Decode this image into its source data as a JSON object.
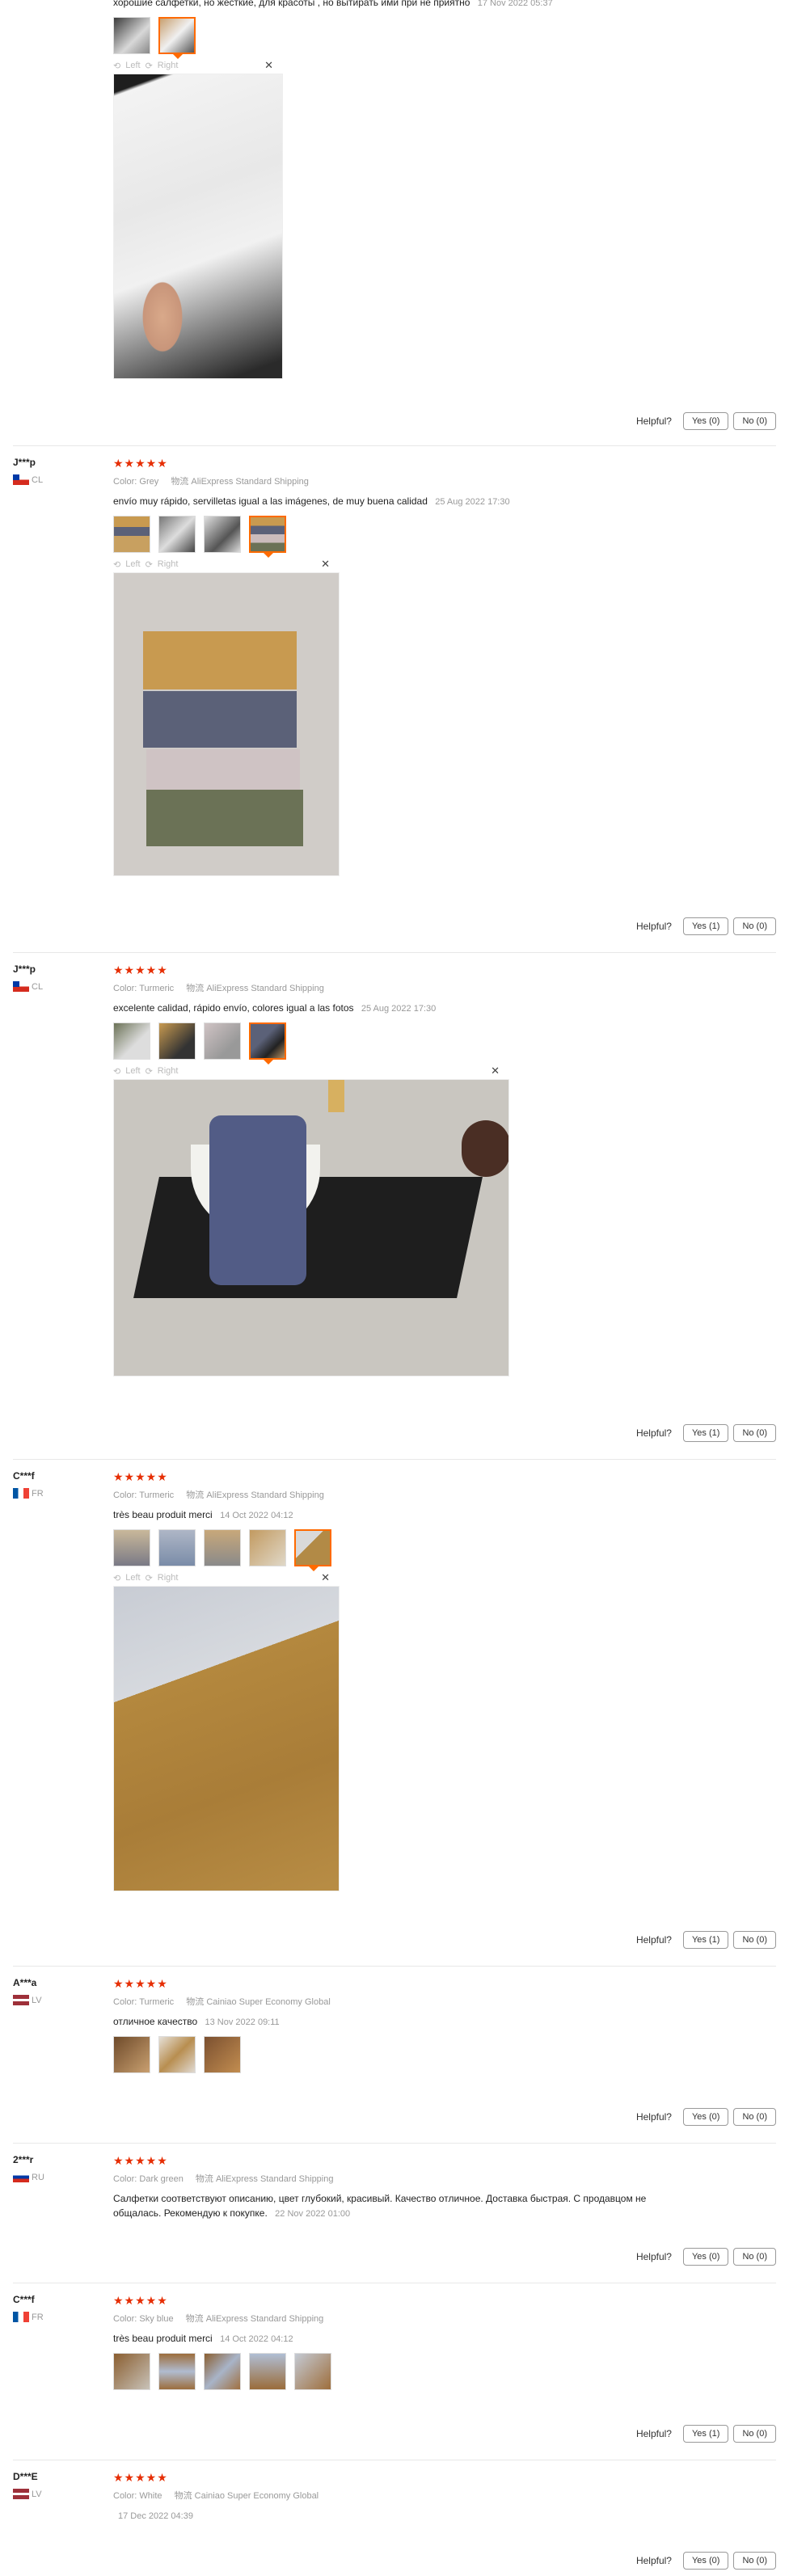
{
  "helpful_label": "Helpful?",
  "rating_stars": "★★★★★",
  "color_prefix": "Color:",
  "ship_prefix": "物流",
  "viewer": {
    "left": "Left",
    "right": "Right",
    "close": "✕"
  },
  "colors": {
    "accent": "#ff6a00",
    "star": "#e62e04"
  },
  "reviews": [
    {
      "text": "хорошие салфетки, но жёсткие, для красоты , но вытирать ими при не приятно",
      "date": "17 Nov 2022 05:37",
      "yes": "Yes (0)",
      "no": "No (0)"
    },
    {
      "user": "J***p",
      "country": "CL",
      "color": "Grey",
      "shipping": "AliExpress Standard Shipping",
      "text": "envío muy rápido, servilletas igual a las imágenes, de muy buena calidad",
      "date": "25 Aug 2022 17:30",
      "yes": "Yes (1)",
      "no": "No (0)"
    },
    {
      "user": "J***p",
      "country": "CL",
      "color": "Turmeric",
      "shipping": "AliExpress Standard Shipping",
      "text": "excelente calidad, rápido envío, colores igual a las fotos",
      "date": "25 Aug 2022 17:30",
      "yes": "Yes (1)",
      "no": "No (0)"
    },
    {
      "user": "C***f",
      "country": "FR",
      "color": "Turmeric",
      "shipping": "AliExpress Standard Shipping",
      "text": "très beau produit merci",
      "date": "14 Oct 2022 04:12",
      "yes": "Yes (1)",
      "no": "No (0)"
    },
    {
      "user": "A***a",
      "country": "LV",
      "color": "Turmeric",
      "shipping": "Cainiao Super Economy Global",
      "text": "отличное качество",
      "date": "13 Nov 2022 09:11",
      "yes": "Yes (0)",
      "no": "No (0)"
    },
    {
      "user": "2***r",
      "country": "RU",
      "color": "Dark green",
      "shipping": "AliExpress Standard Shipping",
      "text": "Салфетки соответствуют описанию, цвет глубокий, красивый. Качество отличное. Доставка быстрая. С продавцом не общалась. Рекомендую к покупке.",
      "date": "22 Nov 2022 01:00",
      "yes": "Yes (0)",
      "no": "No (0)"
    },
    {
      "user": "C***f",
      "country": "FR",
      "color": "Sky blue",
      "shipping": "AliExpress Standard Shipping",
      "text": "très beau produit merci",
      "date": "14 Oct 2022 04:12",
      "yes": "Yes (1)",
      "no": "No (0)"
    },
    {
      "user": "D***E",
      "country": "LV",
      "color": "White",
      "shipping": "Cainiao Super Economy Global",
      "text": "",
      "date": "17 Dec 2022 04:39",
      "yes": "Yes (0)",
      "no": "No (0)"
    }
  ]
}
